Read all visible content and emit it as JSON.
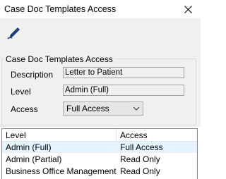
{
  "window": {
    "title": "Case Doc Templates Access",
    "close_icon": "close-icon"
  },
  "toolbar": {
    "edit_icon": "pen-edit-icon",
    "accent": "#1f3f7a"
  },
  "group": {
    "legend": "Case Doc Templates Access",
    "description_label": "Description",
    "description_value": "Letter to Patient",
    "level_label": "Level",
    "level_value": "Admin (Full)",
    "access_label": "Access",
    "access_value": "Full Access"
  },
  "table": {
    "columns": [
      "Level",
      "Access"
    ],
    "rows": [
      {
        "level": "Admin (Full)",
        "access": "Full Access"
      },
      {
        "level": "Admin (Partial)",
        "access": "Read Only"
      },
      {
        "level": "Business Office Management",
        "access": "Read Only"
      }
    ]
  }
}
